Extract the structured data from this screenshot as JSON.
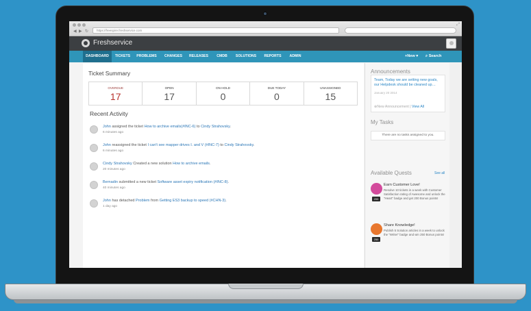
{
  "browser": {
    "url": "https://freespire.freshservice.com"
  },
  "app": {
    "brand": "Freshservice"
  },
  "nav": {
    "items": [
      {
        "label": "DASHBOARD"
      },
      {
        "label": "TICKETS"
      },
      {
        "label": "PROBLEMS"
      },
      {
        "label": "CHANGES"
      },
      {
        "label": "RELEASES"
      },
      {
        "label": "CMDB"
      },
      {
        "label": "SOLUTIONS"
      },
      {
        "label": "REPORTS"
      },
      {
        "label": "ADMIN"
      }
    ],
    "new_label": "+New ▾",
    "search_label": "Search"
  },
  "summary": {
    "title": "Ticket Summary",
    "cells": [
      {
        "label": "OVERDUE",
        "value": "17"
      },
      {
        "label": "OPEN",
        "value": "17"
      },
      {
        "label": "ON HOLD",
        "value": "0"
      },
      {
        "label": "DUE TODAY",
        "value": "0"
      },
      {
        "label": "UNASSIGNED",
        "value": "15"
      }
    ]
  },
  "activity": {
    "title": "Recent Activity",
    "items": [
      {
        "user": "John",
        "mid": " assigned the ticket ",
        "link": "How to archive emails(#INC-6)",
        "mid2": " to ",
        "link2": "Cindy Strahovsky",
        "end": ".",
        "time": "6 minutes ago"
      },
      {
        "user": "John",
        "mid": " reassigned the ticket ",
        "link": "I can't see mapper drives I. and V (#INC-7)",
        "mid2": " to ",
        "link2": "Cindy Strahovsky",
        "end": ".",
        "time": "6 minutes ago"
      },
      {
        "user": "Cindy Strahovsky",
        "mid": " Created a new solution ",
        "link": "How to archive emails",
        "mid2": "",
        "link2": "",
        "end": ".",
        "time": "20 minutes ago"
      },
      {
        "user": "Bernadin",
        "mid": " submitted a new ticket ",
        "link": "Software asset expiry notification (#INC-8)",
        "mid2": "",
        "link2": "",
        "end": ".",
        "time": "40 minutes ago"
      },
      {
        "user": "John",
        "mid": " has detached ",
        "link": "Problem",
        "mid2": " from ",
        "link2": "Getting ES3 backup to speed (#CHN-3)",
        "end": ".",
        "time": "1 day ago"
      }
    ]
  },
  "sidebar": {
    "announcements": {
      "title": "Announcements",
      "text": "Team, Today we are setting new goals, our Helpdesk should be cleaned up…",
      "date": "January 20 2014",
      "new_label": "New Announcement",
      "sep": " | ",
      "view_all": "View All"
    },
    "tasks": {
      "title": "My Tasks",
      "empty": "There are no tasks assigned to you."
    },
    "quests": {
      "title": "Available Quests",
      "see_all": "See all",
      "items": [
        {
          "title": "Earn Customer Love!",
          "desc": "Resolve 10 tickets in a week with Customer Satisfaction rating of Awesome and unlock the \"Heart\" badge and get 200 Bonus points!",
          "points": "200",
          "color": "#d34b9c"
        },
        {
          "title": "Share Knowledge!",
          "desc": "Publish 5 Solution articles in a week to unlock the \"Writer\" badge and win 250 Bonus points!",
          "points": "250",
          "color": "#e8772e"
        }
      ]
    }
  }
}
